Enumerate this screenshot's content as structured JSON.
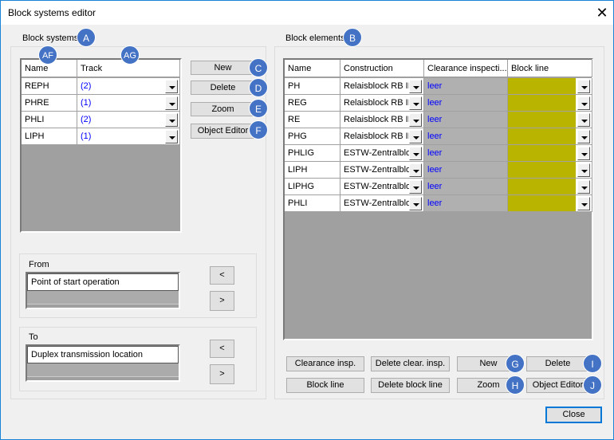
{
  "window": {
    "title": "Block systems editor",
    "close_icon": "close-icon"
  },
  "block_systems": {
    "label": "Block systems",
    "columns": [
      "Name",
      "Track"
    ],
    "rows": [
      {
        "name": "REPH",
        "track": "(2)"
      },
      {
        "name": "PHRE",
        "track": "(1)"
      },
      {
        "name": "PHLI",
        "track": "(2)"
      },
      {
        "name": "LIPH",
        "track": "(1)"
      }
    ],
    "buttons": {
      "new": "New",
      "delete": "Delete",
      "zoom": "Zoom",
      "object_editor": "Object Editor"
    }
  },
  "from": {
    "label": "From",
    "field": "Point of start operation",
    "prev": "<",
    "next": ">"
  },
  "to": {
    "label": "To",
    "field": "Duplex transmission location",
    "prev": "<",
    "next": ">"
  },
  "block_elements": {
    "label": "Block elements",
    "columns": [
      "Name",
      "Construction",
      "Clearance inspecti...",
      "Block line"
    ],
    "rows": [
      {
        "name": "PH",
        "construction": "Relaisblock RB II",
        "clearance": "leer",
        "block_line": ""
      },
      {
        "name": "REG",
        "construction": "Relaisblock RB II",
        "clearance": "leer",
        "block_line": ""
      },
      {
        "name": "RE",
        "construction": "Relaisblock RB II",
        "clearance": "leer",
        "block_line": ""
      },
      {
        "name": "PHG",
        "construction": "Relaisblock RB II",
        "clearance": "leer",
        "block_line": ""
      },
      {
        "name": "PHLIG",
        "construction": "ESTW-Zentralblo",
        "clearance": "leer",
        "block_line": ""
      },
      {
        "name": "LIPH",
        "construction": "ESTW-Zentralblo",
        "clearance": "leer",
        "block_line": ""
      },
      {
        "name": "LIPHG",
        "construction": "ESTW-Zentralblo",
        "clearance": "leer",
        "block_line": ""
      },
      {
        "name": "PHLI",
        "construction": "ESTW-Zentralblo",
        "clearance": "leer",
        "block_line": ""
      }
    ],
    "buttons": {
      "clearance_insp": "Clearance insp.",
      "delete_clear_insp": "Delete clear. insp.",
      "new": "New",
      "delete": "Delete",
      "block_line": "Block line",
      "delete_block_line": "Delete block line",
      "zoom": "Zoom",
      "object_editor": "Object Editor"
    }
  },
  "close_button": "Close",
  "badges": {
    "a": "A",
    "b": "B",
    "c": "C",
    "d": "D",
    "e": "E",
    "f": "F",
    "g": "G",
    "h": "H",
    "i": "I",
    "j": "J",
    "af": "AF",
    "ag": "AG"
  },
  "colors": {
    "badge": "#4472c4",
    "block_line_fill": "#b8b400",
    "link_text": "#0000ff",
    "grid_bg": "#a0a0a0"
  }
}
